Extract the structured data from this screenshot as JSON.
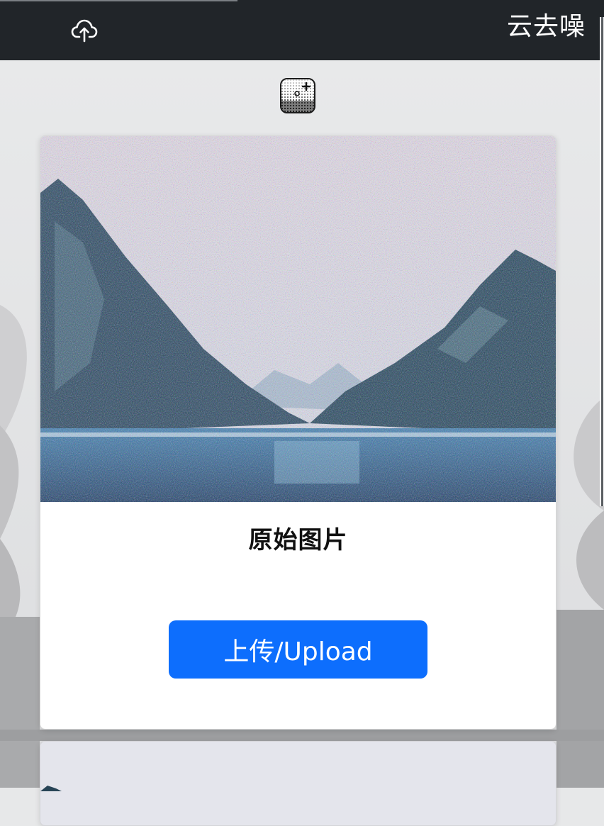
{
  "navbar": {
    "brand": "云去噪",
    "upload_icon": "cloud-upload-icon"
  },
  "logo_icon": "noise-sparkle-icon",
  "original_card": {
    "title": "原始图片",
    "upload_label": "上传/Upload",
    "image_icon": "mountain-lake-noisy-image"
  },
  "colors": {
    "navbar_bg": "#212529",
    "primary_button": "#0d6efd",
    "card_bg": "#ffffff"
  }
}
